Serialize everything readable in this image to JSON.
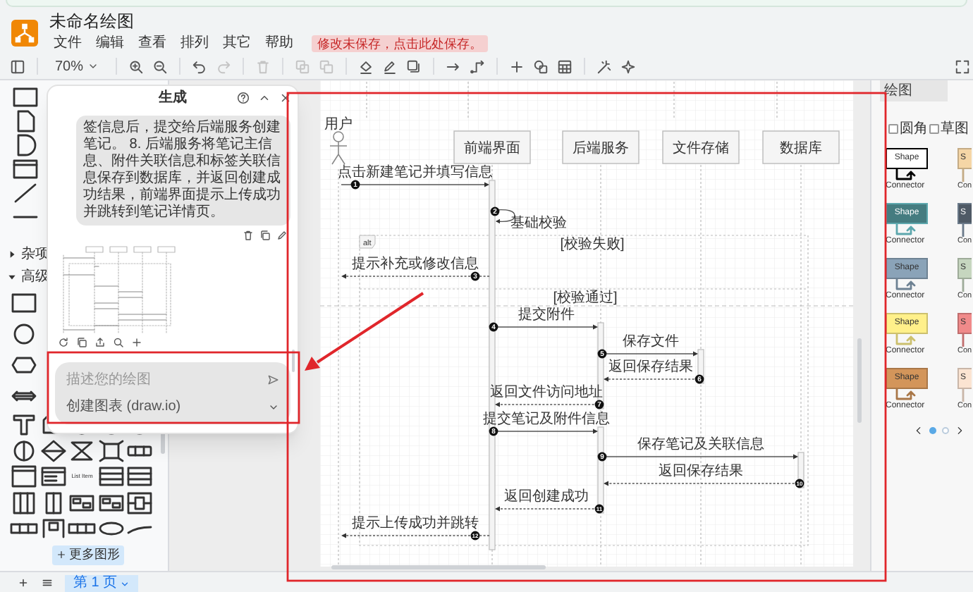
{
  "app": {
    "title": "未命名绘图",
    "menu": [
      "文件",
      "编辑",
      "查看",
      "排列",
      "其它",
      "帮助"
    ],
    "unsaved_notice": "修改未保存，点击此处保存。"
  },
  "toolbar": {
    "tools": [
      {
        "kind": "sidebar",
        "disabled": false
      },
      {
        "kind": "zoom",
        "label": "70%",
        "disabled": false
      },
      {
        "kind": "zoom_in",
        "disabled": false
      },
      {
        "kind": "zoom_out",
        "disabled": false
      },
      {
        "kind": "undo",
        "disabled": false
      },
      {
        "kind": "redo",
        "disabled": true
      },
      {
        "kind": "delete",
        "disabled": true
      },
      {
        "kind": "to_front",
        "disabled": true
      },
      {
        "kind": "to_back",
        "disabled": true
      },
      {
        "kind": "fill",
        "disabled": false
      },
      {
        "kind": "line",
        "disabled": false
      },
      {
        "kind": "shadow",
        "disabled": false
      },
      {
        "kind": "connection",
        "disabled": false
      },
      {
        "kind": "waypoint",
        "disabled": false
      },
      {
        "kind": "insert",
        "disabled": false
      },
      {
        "kind": "shapes",
        "disabled": false
      },
      {
        "kind": "table",
        "disabled": false
      },
      {
        "kind": "format",
        "disabled": false
      },
      {
        "kind": "sparkle",
        "disabled": false
      },
      {
        "kind": "fullscreen",
        "disabled": false
      }
    ]
  },
  "shape_panel": {
    "sections": [
      {
        "label": "杂项",
        "expanded": false
      },
      {
        "label": "高级",
        "expanded": true
      }
    ],
    "list_item_label": "List Item",
    "more_button": "更多图形"
  },
  "generate_dialog": {
    "title": "生成",
    "message": "签信息后，提交给后端服务创建笔记。 8. 后端服务将笔记主信息、附件关联信息和标签关联信息保存到数据库，并返回创建成功结果，前端界面提示上传成功并跳转到笔记详情页。",
    "prompt_placeholder": "描述您的绘图",
    "mode": "创建图表 (draw.io)"
  },
  "diagram": {
    "actor": "用户",
    "participants": [
      "前端界面",
      "后端服务",
      "文件存储",
      "数据库"
    ],
    "frame": {
      "operator": "alt",
      "guards": [
        "[校验失败]",
        "[校验通过]"
      ]
    },
    "messages": [
      {
        "number": "1",
        "text": "点击新建笔记并填写信息",
        "kind": "call"
      },
      {
        "number": "2",
        "text": "基础校验",
        "kind": "self"
      },
      {
        "number": "3",
        "text": "提示补充或修改信息",
        "kind": "return"
      },
      {
        "number": "4",
        "text": "提交附件",
        "kind": "call"
      },
      {
        "number": "5",
        "text": "保存文件",
        "kind": "call"
      },
      {
        "number": "6",
        "text": "返回保存结果",
        "kind": "return"
      },
      {
        "number": "7",
        "text": "返回文件访问地址",
        "kind": "return"
      },
      {
        "number": "8",
        "text": "提交笔记及附件信息",
        "kind": "call"
      },
      {
        "number": "9",
        "text": "保存笔记及关联信息",
        "kind": "call"
      },
      {
        "number": "10",
        "text": "返回保存结果",
        "kind": "return"
      },
      {
        "number": "11",
        "text": "返回创建成功",
        "kind": "return"
      },
      {
        "number": "12",
        "text": "提示上传成功并跳转",
        "kind": "return"
      }
    ]
  },
  "format_panel": {
    "tab": "绘图",
    "options": [
      {
        "label": "圆角",
        "checked": false
      },
      {
        "label": "草图",
        "checked": false
      }
    ],
    "styles": [
      {
        "label": "Shape",
        "connector": "Connector",
        "color": "#ffffff"
      },
      {
        "label": "S",
        "connector": "Con",
        "color": "#f5d6a6"
      },
      {
        "label": "Shape",
        "connector": "Connector",
        "color": "#457c80"
      },
      {
        "label": "S",
        "connector": "Con",
        "color": "#4f5a66"
      },
      {
        "label": "Shape",
        "connector": "Connector",
        "color": "#8aa3b8"
      },
      {
        "label": "S",
        "connector": "Con",
        "color": "#c6d6bf"
      },
      {
        "label": "Shape",
        "connector": "Connector",
        "color": "#fff08a"
      },
      {
        "label": "S",
        "connector": "Con",
        "color": "#f08a8a"
      },
      {
        "label": "Shape",
        "connector": "Connector",
        "color": "#d3955a"
      },
      {
        "label": "S",
        "connector": "Con",
        "color": "#fbe4d2"
      }
    ],
    "pager": [
      {
        "selected": true
      },
      {
        "selected": false
      }
    ]
  },
  "page_tabs": [
    {
      "label": "第 1 页",
      "selected": true
    }
  ]
}
